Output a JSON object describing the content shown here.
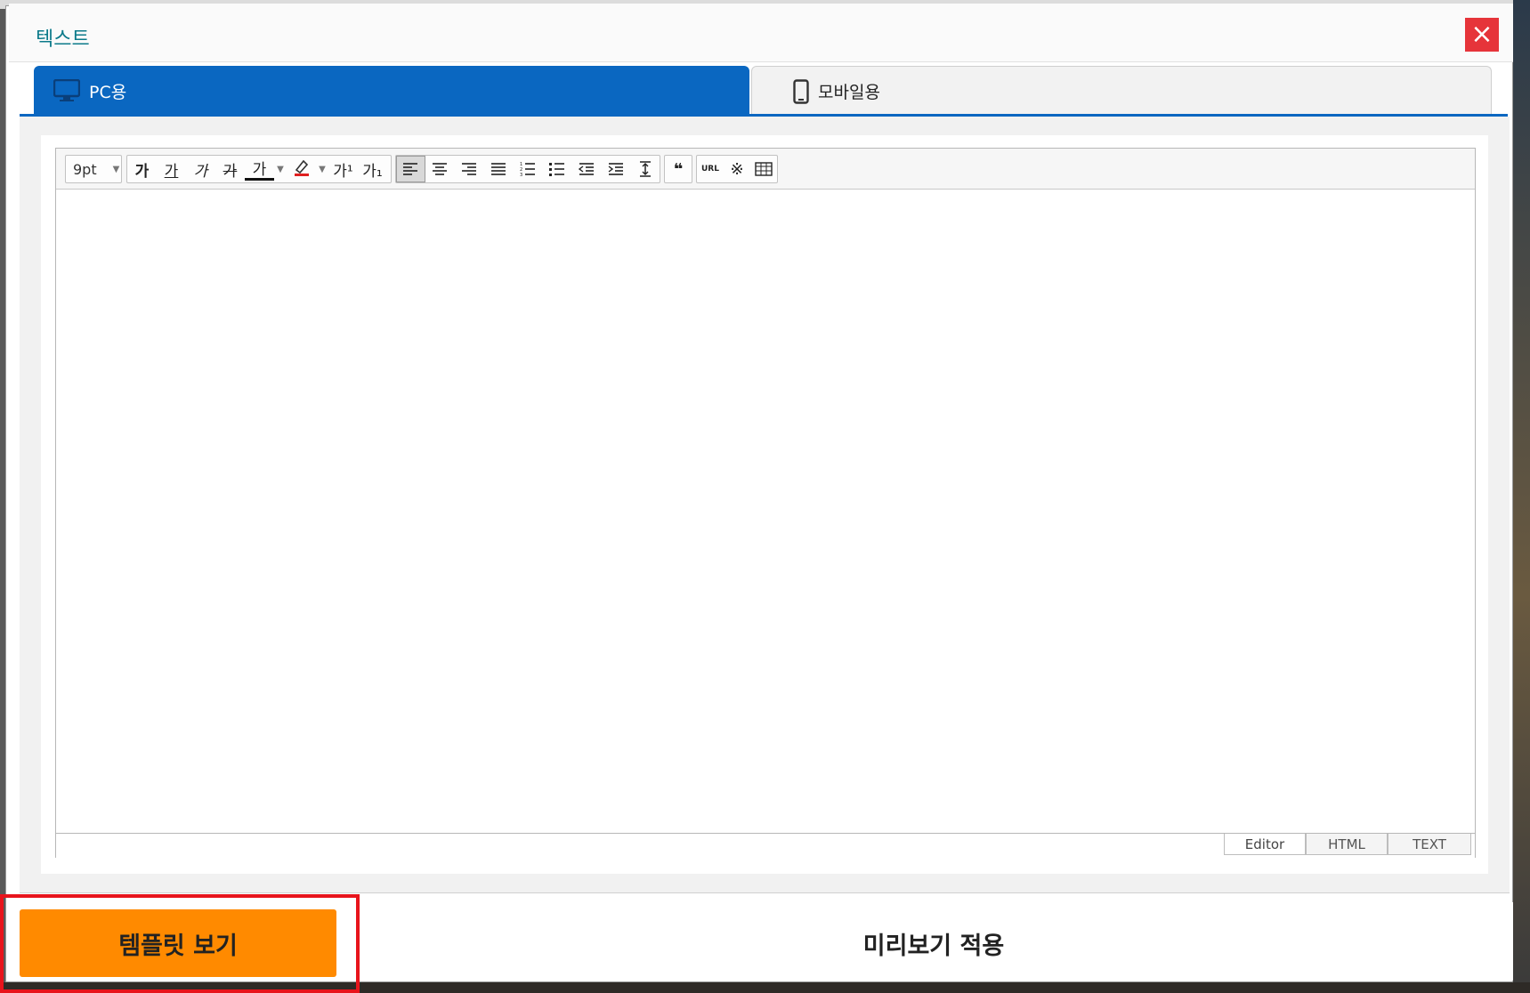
{
  "dialog": {
    "title": "텍스트",
    "close_label": "×"
  },
  "tabs": [
    {
      "label": "PC용",
      "icon": "monitor-icon",
      "active": true
    },
    {
      "label": "모바일용",
      "icon": "mobile-icon",
      "active": false
    }
  ],
  "toolbar": {
    "font_size": "9pt",
    "bold": "가",
    "underline": "가",
    "italic": "가",
    "strike": "가",
    "font_color": "가",
    "superscript": "가¹",
    "subscript": "가₁",
    "url": "URL",
    "special_char": "※",
    "quote": "❝"
  },
  "editor": {
    "modes": [
      "Editor",
      "HTML",
      "TEXT"
    ],
    "active_mode": "Editor"
  },
  "footer": {
    "template_button": "템플릿 보기",
    "preview_button": "미리보기 적용"
  },
  "colors": {
    "tab_active": "#0a67c1",
    "close": "#e6343a",
    "template_button": "#ff8a00",
    "highlight": "#e8141c",
    "title": "#0c7a8a"
  }
}
